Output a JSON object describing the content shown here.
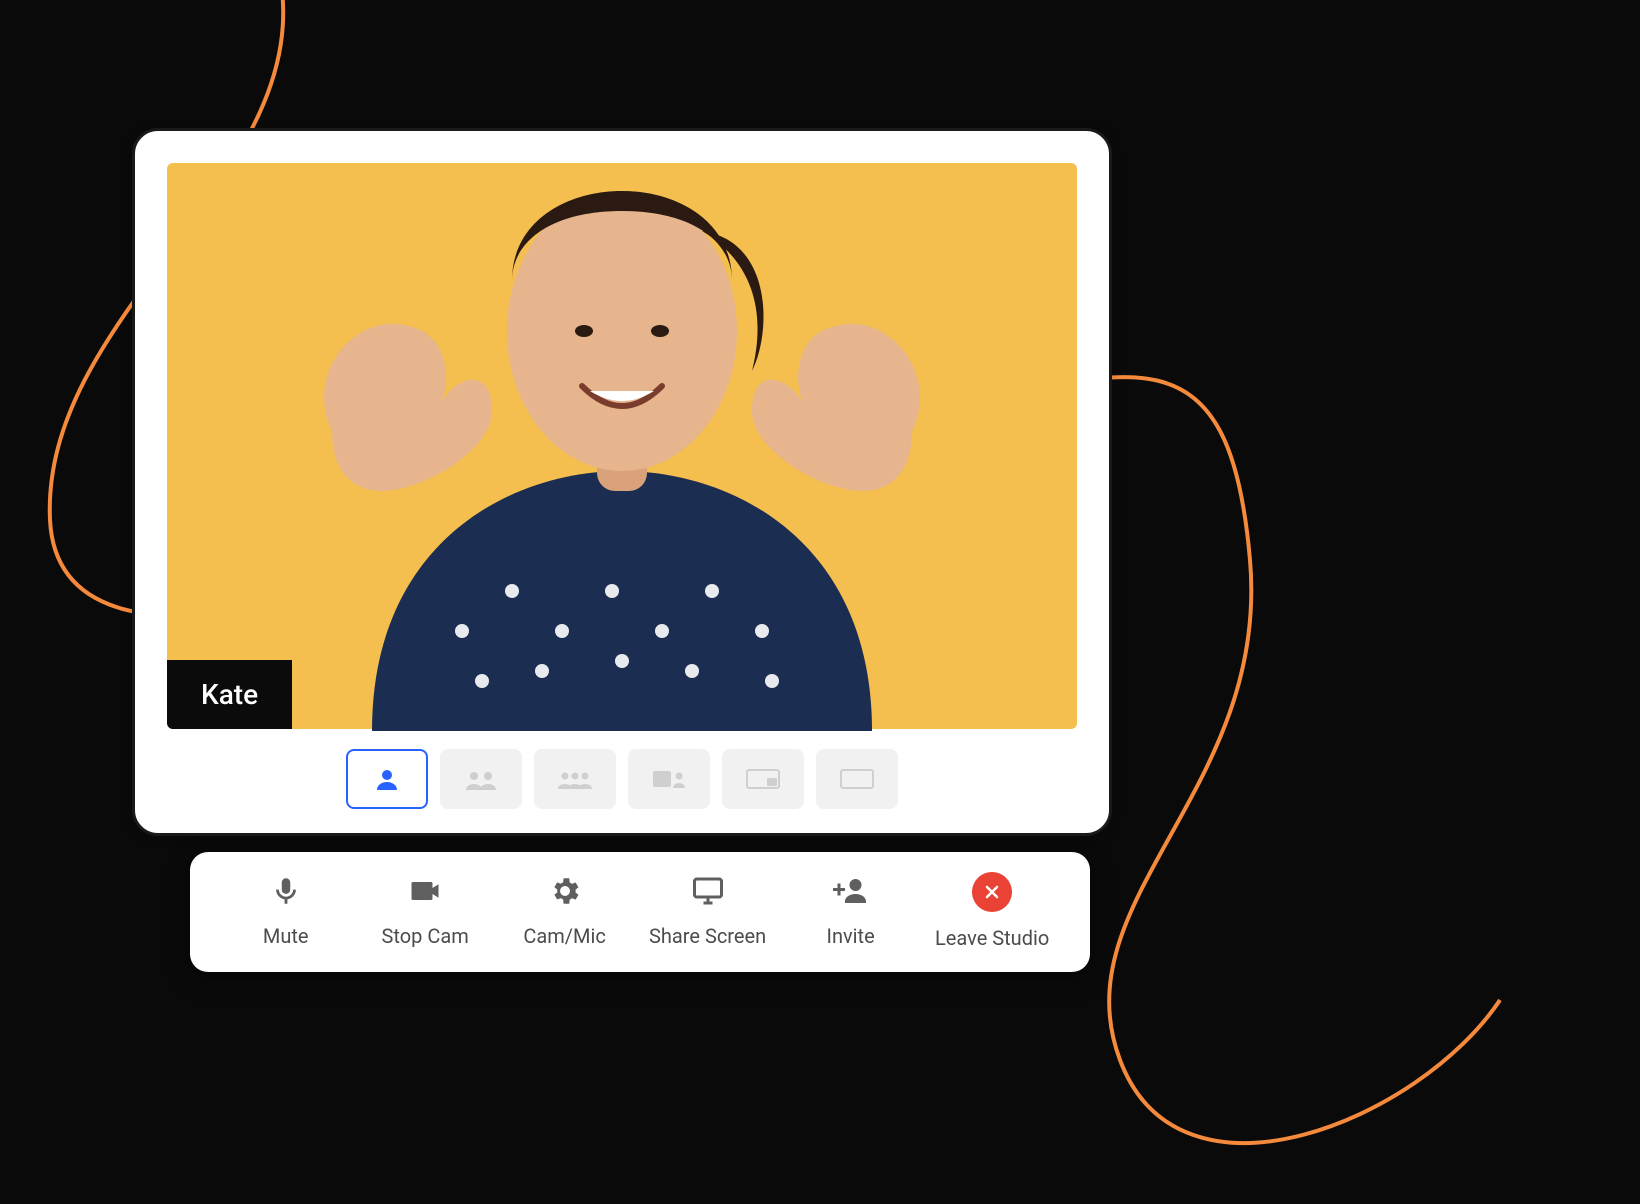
{
  "colors": {
    "accent_blue": "#2962ff",
    "leave_red": "#ea4335",
    "video_bg": "#f4bf4e",
    "ribbon_orange": "#f58a3c"
  },
  "participant": {
    "name": "Kate"
  },
  "layouts": {
    "active_index": 0,
    "count": 6,
    "kinds": [
      "single",
      "duo",
      "trio",
      "screen-duo",
      "pip",
      "blank"
    ]
  },
  "controls": {
    "mute": {
      "label": "Mute",
      "icon": "microphone-icon"
    },
    "stopcam": {
      "label": "Stop Cam",
      "icon": "camera-icon"
    },
    "cammic": {
      "label": "Cam/Mic",
      "icon": "gear-icon"
    },
    "share": {
      "label": "Share Screen",
      "icon": "monitor-icon"
    },
    "invite": {
      "label": "Invite",
      "icon": "invite-person-icon"
    },
    "leave": {
      "label": "Leave Studio",
      "icon": "close-icon"
    }
  }
}
